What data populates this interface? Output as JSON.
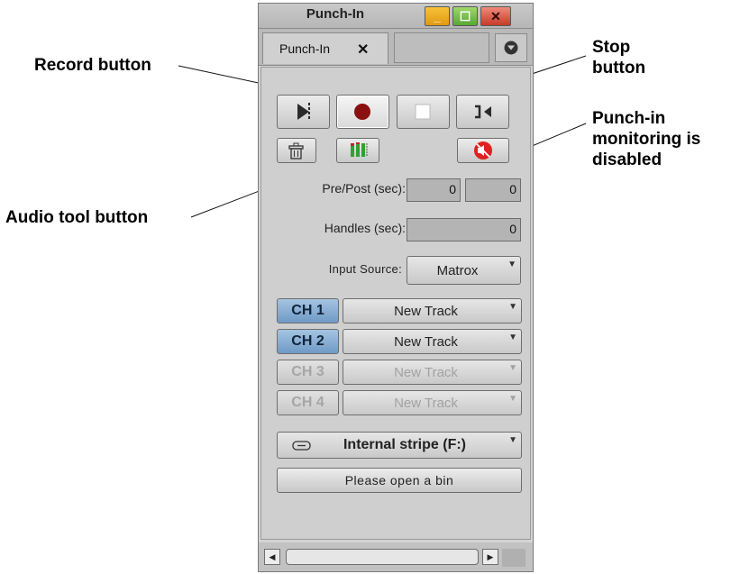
{
  "window": {
    "title": "Punch-In",
    "minimize_glyph": "_",
    "maximize_glyph": "☐",
    "close_glyph": "✕"
  },
  "tab": {
    "label": "Punch-In",
    "close_glyph": "✕",
    "menu_icon": "chevron-down-circle-icon"
  },
  "transport": {
    "play_icon": "play-to-mark-icon",
    "record_icon": "record-icon",
    "stop_icon": "stop-icon",
    "jump_icon": "jump-to-mark-icon"
  },
  "tools": {
    "trash_icon": "trash-icon",
    "audio_tool_icon": "audio-meter-icon",
    "monitoring_icon": "speaker-muted-icon"
  },
  "fields": {
    "prepost_label": "Pre/Post (sec):",
    "pre_value": "0",
    "post_value": "0",
    "handles_label": "Handles (sec):",
    "handles_value": "0",
    "input_source_label": "Input Source:",
    "input_source_value": "Matrox"
  },
  "channels": [
    {
      "label": "CH 1",
      "track": "New Track",
      "enabled": true
    },
    {
      "label": "CH 2",
      "track": "New Track",
      "enabled": true
    },
    {
      "label": "CH 3",
      "track": "New Track",
      "enabled": false
    },
    {
      "label": "CH 4",
      "track": "New Track",
      "enabled": false
    }
  ],
  "timecode_source": {
    "icon": "tape-icon",
    "value": "Internal stripe (F:)"
  },
  "bin_button": "Please open a bin",
  "scrollbar": {
    "left_glyph": "◀",
    "right_glyph": "▶"
  },
  "callouts": {
    "record": "Record button",
    "stop": "Stop\nbutton",
    "monitoring": "Punch-in\nmonitoring is\ndisabled",
    "audio_tool": "Audio tool button"
  },
  "colors": {
    "record_red": "#8b1010",
    "monitor_red": "#e02020",
    "channel_active": "#7ba2cc",
    "meter_green": "#2fa22f",
    "meter_red": "#c02626"
  }
}
